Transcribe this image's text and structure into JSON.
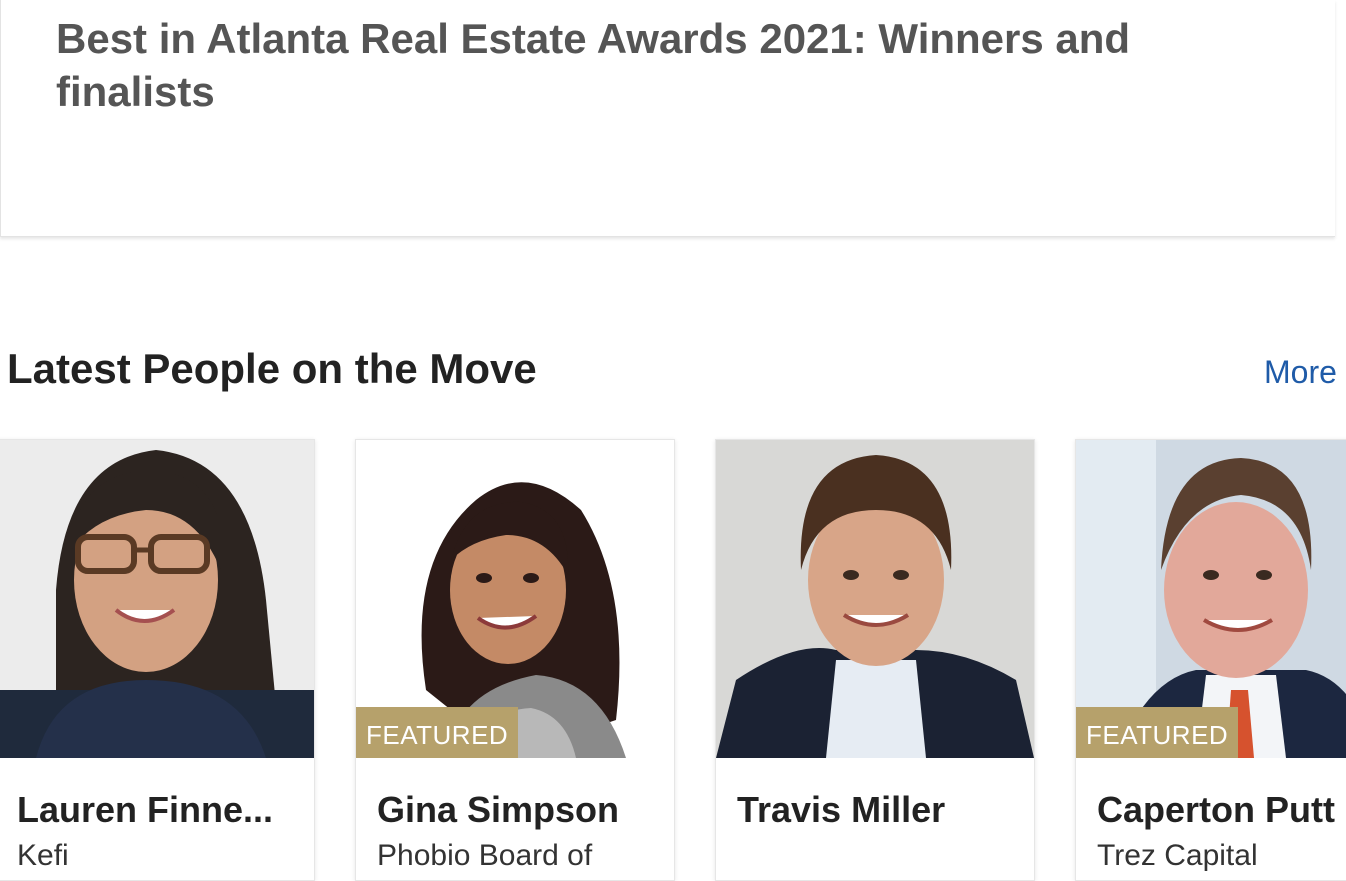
{
  "article": {
    "title": "Best in Atlanta Real Estate Awards 2021: Winners and finalists"
  },
  "section": {
    "title": "Latest People on the Move",
    "more_label": "More"
  },
  "people": [
    {
      "name": "Lauren Finne...",
      "company": "Kefi",
      "featured_label": ""
    },
    {
      "name": "Gina Simpson",
      "company": "Phobio Board of",
      "featured_label": "FEATURED"
    },
    {
      "name": "Travis Miller",
      "company": "",
      "featured_label": ""
    },
    {
      "name": "Caperton Putt",
      "company": "Trez Capital",
      "featured_label": "FEATURED"
    }
  ],
  "colors": {
    "accent_link": "#1f5ba8",
    "featured_badge": "#b6a16b",
    "heading": "#222222",
    "article_title": "#555555"
  }
}
